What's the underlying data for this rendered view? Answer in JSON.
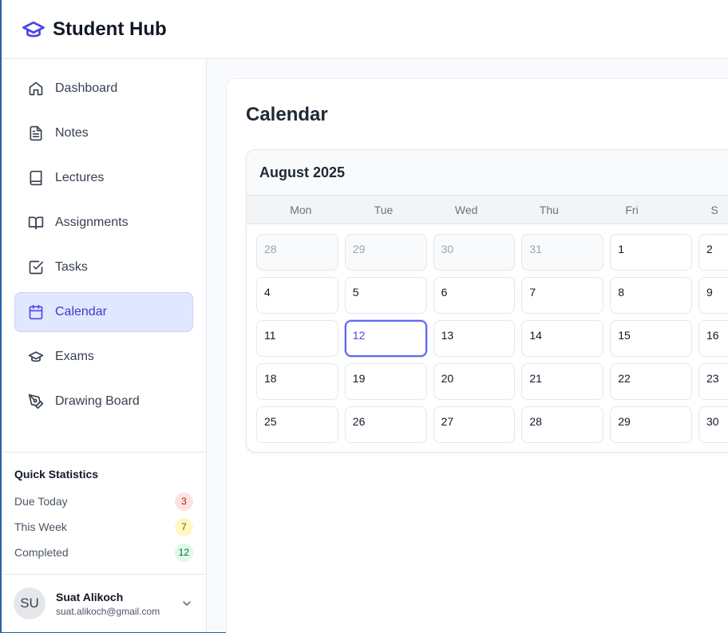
{
  "header": {
    "title": "Student Hub",
    "logo_icon": "graduation-cap-icon"
  },
  "sidebar": {
    "items": [
      {
        "label": "Dashboard",
        "icon": "home-icon",
        "active": false
      },
      {
        "label": "Notes",
        "icon": "file-text-icon",
        "active": false
      },
      {
        "label": "Lectures",
        "icon": "book-icon",
        "active": false
      },
      {
        "label": "Assignments",
        "icon": "book-open-icon",
        "active": false
      },
      {
        "label": "Tasks",
        "icon": "check-square-icon",
        "active": false
      },
      {
        "label": "Calendar",
        "icon": "calendar-icon",
        "active": true
      },
      {
        "label": "Exams",
        "icon": "graduation-cap-icon",
        "active": false
      },
      {
        "label": "Drawing Board",
        "icon": "pen-tool-icon",
        "active": false
      }
    ],
    "stats": {
      "title": "Quick Statistics",
      "rows": [
        {
          "label": "Due Today",
          "value": "3",
          "color": "#fee2e2"
        },
        {
          "label": "This Week",
          "value": "7",
          "color": "#fef9c3"
        },
        {
          "label": "Completed",
          "value": "12",
          "color": "#dcfce7"
        }
      ]
    },
    "user": {
      "initials": "SU",
      "name": "Suat Alikoch",
      "email": "suat.alikoch@gmail.com"
    }
  },
  "main": {
    "title": "Calendar",
    "calendar": {
      "month": "August 2025",
      "weekdays": [
        "Mon",
        "Tue",
        "Wed",
        "Thu",
        "Fri",
        "S"
      ],
      "weeks": [
        [
          "28",
          "29",
          "30",
          "31",
          "1",
          "2"
        ],
        [
          "4",
          "5",
          "6",
          "7",
          "8",
          "9"
        ],
        [
          "11",
          "12",
          "13",
          "14",
          "15",
          "16"
        ],
        [
          "18",
          "19",
          "20",
          "21",
          "22",
          "23"
        ],
        [
          "25",
          "26",
          "27",
          "28",
          "29",
          "30"
        ]
      ],
      "muted_days": [
        "0-0",
        "0-1",
        "0-2",
        "0-3"
      ],
      "today": "2-1",
      "accent": "#6366f1"
    }
  }
}
